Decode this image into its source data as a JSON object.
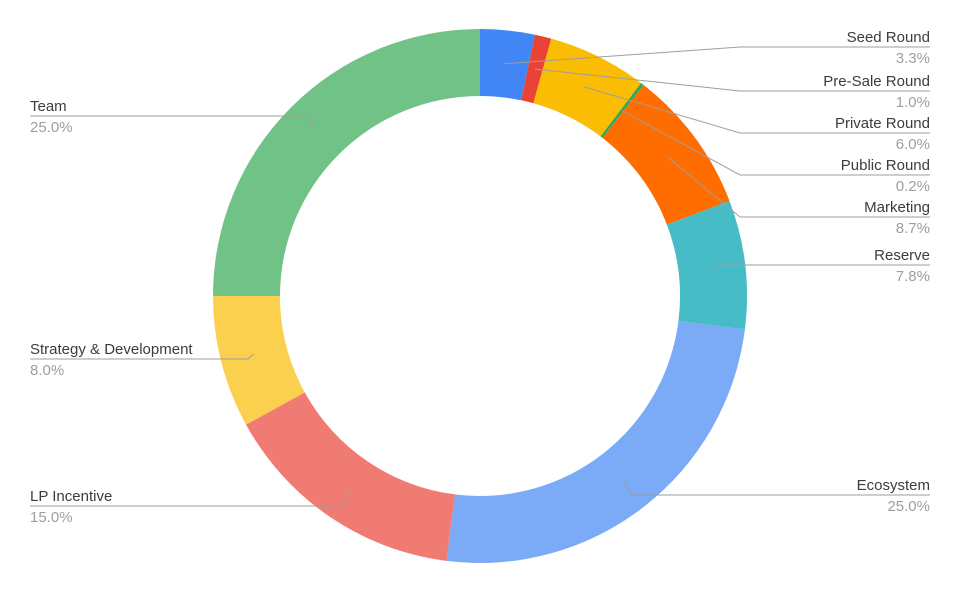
{
  "chart_data": {
    "type": "pie",
    "donut": true,
    "title": "",
    "start_angle": "12 o'clock",
    "direction": "clockwise",
    "slices": [
      {
        "label": "Seed Round",
        "value": 3.3,
        "display": "3.3%",
        "color": "#4285f4",
        "label_side": "right"
      },
      {
        "label": "Pre-Sale Round",
        "value": 1.0,
        "display": "1.0%",
        "color": "#ea4335",
        "label_side": "right"
      },
      {
        "label": "Private Round",
        "value": 6.0,
        "display": "6.0%",
        "color": "#fbbc04",
        "label_side": "right"
      },
      {
        "label": "Public Round",
        "value": 0.2,
        "display": "0.2%",
        "color": "#34a853",
        "label_side": "right"
      },
      {
        "label": "Marketing",
        "value": 8.7,
        "display": "8.7%",
        "color": "#ff6d01",
        "label_side": "right"
      },
      {
        "label": "Reserve",
        "value": 7.8,
        "display": "7.8%",
        "color": "#46bdc6",
        "label_side": "right"
      },
      {
        "label": "Ecosystem",
        "value": 25.0,
        "display": "25.0%",
        "color": "#7baaf7",
        "label_side": "right"
      },
      {
        "label": "LP Incentive",
        "value": 15.0,
        "display": "15.0%",
        "color": "#f07b72",
        "label_side": "left"
      },
      {
        "label": "Strategy & Development",
        "value": 8.0,
        "display": "8.0%",
        "color": "#fcd04f",
        "label_side": "left"
      },
      {
        "label": "Team",
        "value": 25.0,
        "display": "25.0%",
        "color": "#71c287",
        "label_side": "left"
      }
    ],
    "legend": "none (callout labels)"
  }
}
